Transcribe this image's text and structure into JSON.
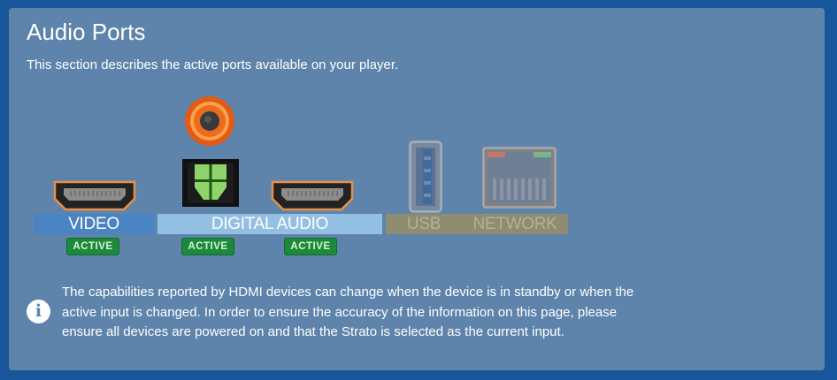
{
  "section": {
    "title": "Audio Ports",
    "description": "This section describes the active ports available on your player."
  },
  "ports": {
    "labels": {
      "video": "VIDEO",
      "digital_audio": "DIGITAL AUDIO",
      "usb": "USB",
      "network": "NETWORK"
    },
    "badges": [
      "ACTIVE",
      "ACTIVE",
      "ACTIVE"
    ],
    "icons": [
      "hdmi-port-icon",
      "coaxial-port-icon",
      "optical-port-icon",
      "hdmi-port-icon",
      "usb-port-icon",
      "network-port-icon"
    ]
  },
  "info": {
    "icon": "info-icon",
    "glyph": "i",
    "note": "The capabilities reported by HDMI devices can change when the device is in standby or when the active input is changed. In order to ensure the accuracy of the information on this page, please ensure all devices are powered on and that the Strato is selected as the current input."
  },
  "colors": {
    "background": "#17569a",
    "panel": "#5e84ab",
    "video_label": "#4a84c2",
    "digital_label": "#93bfe2",
    "inactive_label": "#8f8c72",
    "active_badge": "#1c8a3a"
  }
}
